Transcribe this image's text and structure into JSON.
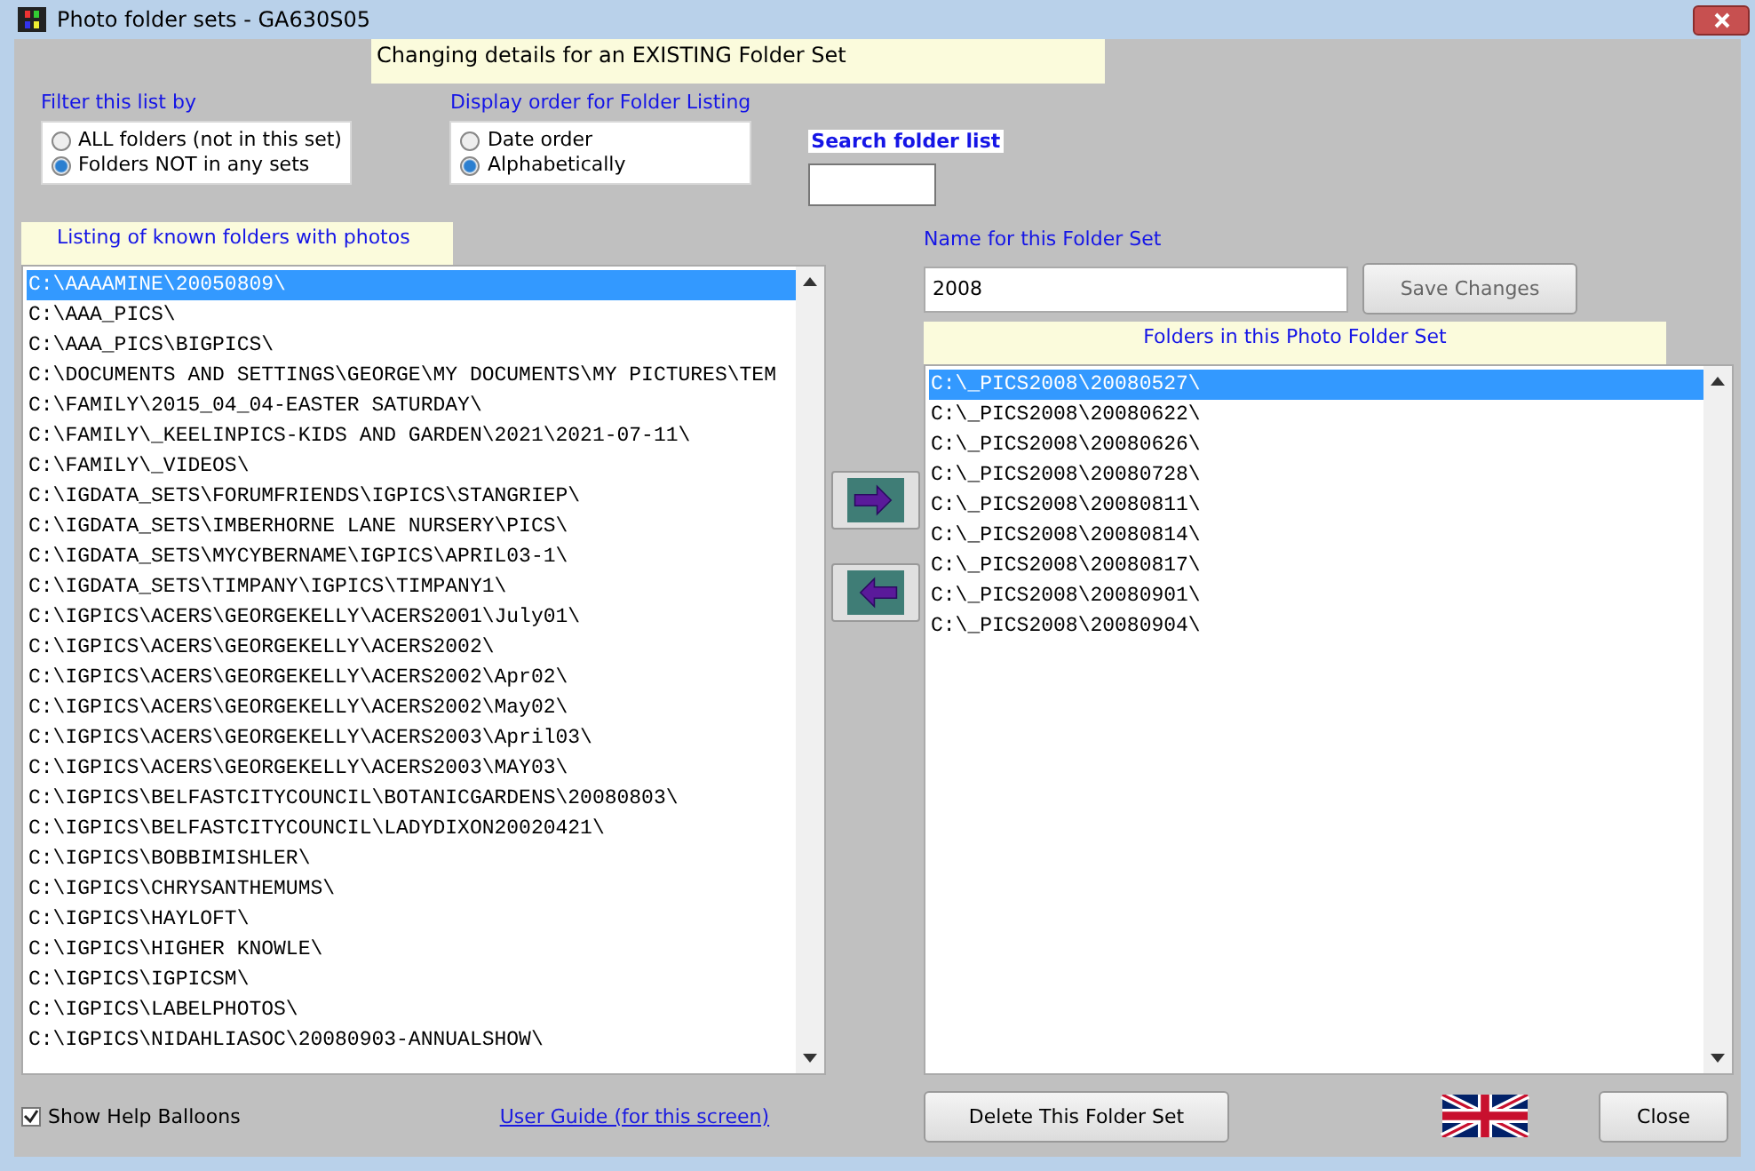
{
  "window": {
    "title": "Photo folder sets - GA630S05"
  },
  "banner": "Changing details for an EXISTING Folder Set",
  "filter": {
    "label": "Filter this list by",
    "options": [
      {
        "label": "ALL folders (not in this set)",
        "selected": false
      },
      {
        "label": "Folders NOT in any sets",
        "selected": true
      }
    ]
  },
  "order": {
    "label": "Display order for Folder Listing",
    "options": [
      {
        "label": "Date order",
        "selected": false
      },
      {
        "label": "Alphabetically",
        "selected": true
      }
    ]
  },
  "search": {
    "label": "Search folder list"
  },
  "known_folders": {
    "label": "Listing of known folders with photos",
    "items": [
      {
        "text": "C:\\AAAAMINE\\20050809\\",
        "selected": true
      },
      {
        "text": "C:\\AAA_PICS\\",
        "selected": false
      },
      {
        "text": "C:\\AAA_PICS\\BIGPICS\\",
        "selected": false
      },
      {
        "text": "C:\\DOCUMENTS AND SETTINGS\\GEORGE\\MY DOCUMENTS\\MY PICTURES\\TEM",
        "selected": false
      },
      {
        "text": "C:\\FAMILY\\2015_04_04-EASTER SATURDAY\\",
        "selected": false
      },
      {
        "text": "C:\\FAMILY\\_KEELINPICS-KIDS AND GARDEN\\2021\\2021-07-11\\",
        "selected": false
      },
      {
        "text": "C:\\FAMILY\\_VIDEOS\\",
        "selected": false
      },
      {
        "text": "C:\\IGDATA_SETS\\FORUMFRIENDS\\IGPICS\\STANGRIEP\\",
        "selected": false
      },
      {
        "text": "C:\\IGDATA_SETS\\IMBERHORNE LANE NURSERY\\PICS\\",
        "selected": false
      },
      {
        "text": "C:\\IGDATA_SETS\\MYCYBERNAME\\IGPICS\\APRIL03-1\\",
        "selected": false
      },
      {
        "text": "C:\\IGDATA_SETS\\TIMPANY\\IGPICS\\TIMPANY1\\",
        "selected": false
      },
      {
        "text": "C:\\IGPICS\\ACERS\\GEORGEKELLY\\ACERS2001\\July01\\",
        "selected": false
      },
      {
        "text": "C:\\IGPICS\\ACERS\\GEORGEKELLY\\ACERS2002\\",
        "selected": false
      },
      {
        "text": "C:\\IGPICS\\ACERS\\GEORGEKELLY\\ACERS2002\\Apr02\\",
        "selected": false
      },
      {
        "text": "C:\\IGPICS\\ACERS\\GEORGEKELLY\\ACERS2002\\May02\\",
        "selected": false
      },
      {
        "text": "C:\\IGPICS\\ACERS\\GEORGEKELLY\\ACERS2003\\April03\\",
        "selected": false
      },
      {
        "text": "C:\\IGPICS\\ACERS\\GEORGEKELLY\\ACERS2003\\MAY03\\",
        "selected": false
      },
      {
        "text": "C:\\IGPICS\\BELFASTCITYCOUNCIL\\BOTANICGARDENS\\20080803\\",
        "selected": false
      },
      {
        "text": "C:\\IGPICS\\BELFASTCITYCOUNCIL\\LADYDIXON20020421\\",
        "selected": false
      },
      {
        "text": "C:\\IGPICS\\BOBBIMISHLER\\",
        "selected": false
      },
      {
        "text": "C:\\IGPICS\\CHRYSANTHEMUMS\\",
        "selected": false
      },
      {
        "text": "C:\\IGPICS\\HAYLOFT\\",
        "selected": false
      },
      {
        "text": "C:\\IGPICS\\HIGHER KNOWLE\\",
        "selected": false
      },
      {
        "text": "C:\\IGPICS\\IGPICSM\\",
        "selected": false
      },
      {
        "text": "C:\\IGPICS\\LABELPHOTOS\\",
        "selected": false
      },
      {
        "text": "C:\\IGPICS\\NIDAHLIASOC\\20080903-ANNUALSHOW\\",
        "selected": false
      }
    ]
  },
  "set_name": {
    "label": "Name for this Folder Set",
    "value": "2008"
  },
  "save_button": "Save Changes",
  "set_folders": {
    "label": "Folders in this Photo Folder Set",
    "items": [
      {
        "text": "C:\\_PICS2008\\20080527\\",
        "selected": true
      },
      {
        "text": "C:\\_PICS2008\\20080622\\",
        "selected": false
      },
      {
        "text": "C:\\_PICS2008\\20080626\\",
        "selected": false
      },
      {
        "text": "C:\\_PICS2008\\20080728\\",
        "selected": false
      },
      {
        "text": "C:\\_PICS2008\\20080811\\",
        "selected": false
      },
      {
        "text": "C:\\_PICS2008\\20080814\\",
        "selected": false
      },
      {
        "text": "C:\\_PICS2008\\20080817\\",
        "selected": false
      },
      {
        "text": "C:\\_PICS2008\\20080901\\",
        "selected": false
      },
      {
        "text": "C:\\_PICS2008\\20080904\\",
        "selected": false
      }
    ]
  },
  "help_balloons": {
    "label": "Show Help Balloons",
    "checked": true
  },
  "user_guide_link": "User Guide (for this screen)",
  "delete_button": "Delete This Folder Set",
  "close_button": "Close"
}
